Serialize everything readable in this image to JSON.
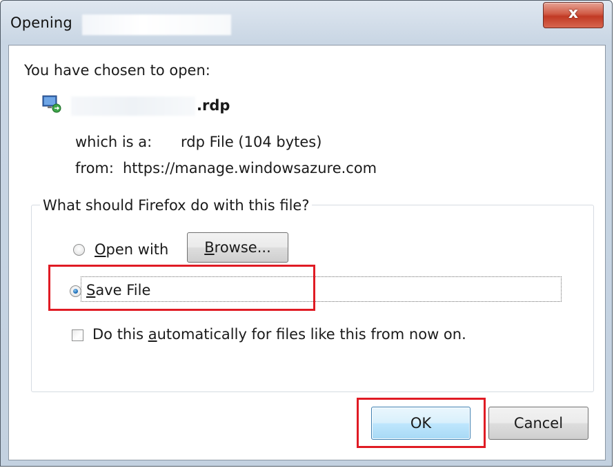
{
  "window": {
    "title": "Opening",
    "close_label": "x"
  },
  "dialog": {
    "intro": "You have chosen to open:",
    "file_name_suffix": ".rdp",
    "which_is_label": "which is a:",
    "which_is_value": "rdp File (104 bytes)",
    "from_label": "from:",
    "from_value": "https://manage.windowsazure.com"
  },
  "group": {
    "label": "What should Firefox do with this file?",
    "open_with": {
      "pre": "",
      "accel": "O",
      "post": "pen with",
      "selected": false
    },
    "browse": {
      "pre": "",
      "accel": "B",
      "post": "rowse..."
    },
    "save_file": {
      "pre": "",
      "accel": "S",
      "post": "ave File",
      "selected": true
    },
    "auto": {
      "pre": "Do this ",
      "accel": "a",
      "post": "utomatically for files like this from now on.",
      "checked": false
    }
  },
  "buttons": {
    "ok": "OK",
    "cancel": "Cancel"
  },
  "colors": {
    "highlight": "#e01b24",
    "default_button": "#bee6fd"
  }
}
